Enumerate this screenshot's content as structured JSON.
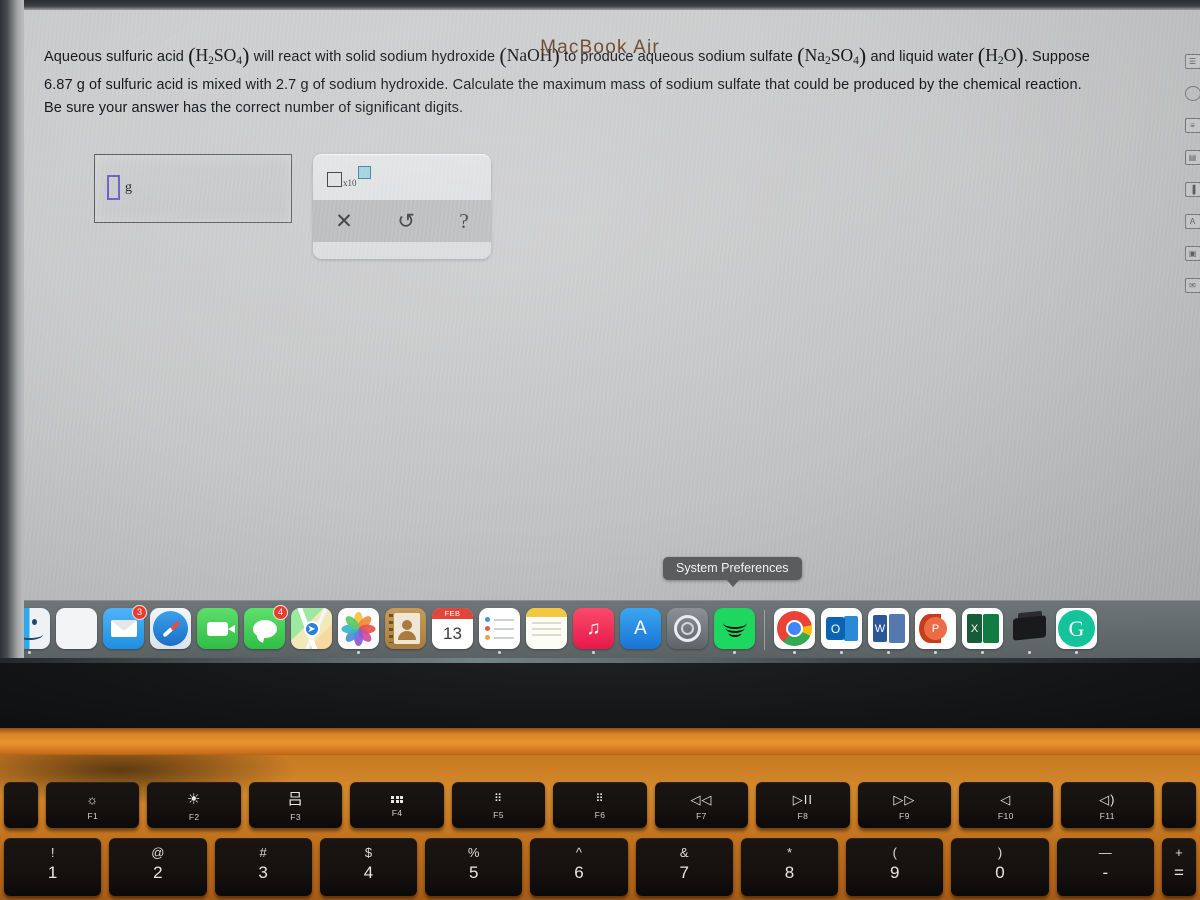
{
  "problem": {
    "line1_a": "Aqueous sulfuric acid ",
    "f_h2so4": "H2SO4",
    "line1_b": " will react with solid sodium hydroxide ",
    "f_naoh": "NaOH",
    "line1_c": " to produce aqueous sodium sulfate ",
    "f_na2so4": "Na2SO4",
    "line1_d": " and liquid water ",
    "f_h2o": "H2O",
    "line1_e": ". Suppose",
    "line2": "6.87 g of sulfuric acid is mixed with 2.7 g of sodium hydroxide. Calculate the maximum mass of sodium sulfate that could be produced by the chemical reaction.",
    "line3": "Be sure your answer has the correct number of significant digits."
  },
  "answer": {
    "value": "",
    "placeholder": "",
    "unit": "g"
  },
  "toolbar": {
    "sci_notation_label": "x10",
    "clear_label": "✕",
    "undo_label": "↺",
    "help_label": "?"
  },
  "right_rail": {
    "items": [
      {
        "name": "page-icon",
        "glyph": "☰"
      },
      {
        "name": "circle-icon",
        "glyph": ""
      },
      {
        "name": "list-icon",
        "glyph": "≡"
      },
      {
        "name": "book-icon",
        "glyph": "▤"
      },
      {
        "name": "chart-icon",
        "glyph": "▐"
      },
      {
        "name": "font-icon",
        "glyph": "A"
      },
      {
        "name": "window-icon",
        "glyph": "▣"
      },
      {
        "name": "mail-icon",
        "glyph": "✉"
      }
    ]
  },
  "tooltip": {
    "text": "System Preferences"
  },
  "dock": {
    "items": [
      {
        "name": "finder",
        "badge": null
      },
      {
        "name": "launchpad",
        "badge": null
      },
      {
        "name": "mail",
        "badge": "3"
      },
      {
        "name": "safari",
        "badge": null
      },
      {
        "name": "facetime",
        "badge": null
      },
      {
        "name": "messages",
        "badge": "4"
      },
      {
        "name": "maps",
        "badge": null
      },
      {
        "name": "photos",
        "badge": null
      },
      {
        "name": "contacts",
        "badge": null
      },
      {
        "name": "calendar",
        "badge": null,
        "month": "FEB",
        "day": "13"
      },
      {
        "name": "reminders",
        "badge": null
      },
      {
        "name": "notes",
        "badge": null
      },
      {
        "name": "music",
        "badge": null
      },
      {
        "name": "app-store",
        "badge": null
      },
      {
        "name": "system-preferences",
        "badge": null
      },
      {
        "name": "spotify",
        "badge": null
      },
      {
        "name": "chrome",
        "badge": null
      },
      {
        "name": "outlook",
        "badge": null,
        "letter": "O"
      },
      {
        "name": "word",
        "badge": null,
        "letter": "W"
      },
      {
        "name": "powerpoint",
        "badge": null,
        "letter": "P"
      },
      {
        "name": "excel",
        "badge": null,
        "letter": "X"
      },
      {
        "name": "printer",
        "badge": null
      },
      {
        "name": "grammarly",
        "badge": null,
        "letter": "G"
      }
    ]
  },
  "laptop": {
    "model": "MacBook Air"
  },
  "keyboard": {
    "function_row": [
      {
        "label": "F1",
        "glyph": "brightness-down"
      },
      {
        "label": "F2",
        "glyph": "brightness-up"
      },
      {
        "label": "F3",
        "glyph": "mission-control"
      },
      {
        "label": "F4",
        "glyph": "launchpad"
      },
      {
        "label": "F5",
        "glyph": "keyboard-dim"
      },
      {
        "label": "F6",
        "glyph": "keyboard-bright"
      },
      {
        "label": "F7",
        "glyph": "◁◁"
      },
      {
        "label": "F8",
        "glyph": "▷II"
      },
      {
        "label": "F9",
        "glyph": "▷▷"
      },
      {
        "label": "F10",
        "glyph": "◁"
      },
      {
        "label": "F11",
        "glyph": "◁)"
      }
    ],
    "number_row": [
      {
        "upper": "!",
        "lower": "1"
      },
      {
        "upper": "@",
        "lower": "2"
      },
      {
        "upper": "#",
        "lower": "3"
      },
      {
        "upper": "$",
        "lower": "4"
      },
      {
        "upper": "%",
        "lower": "5"
      },
      {
        "upper": "^",
        "lower": "6"
      },
      {
        "upper": "&",
        "lower": "7"
      },
      {
        "upper": "*",
        "lower": "8"
      },
      {
        "upper": "(",
        "lower": "9"
      },
      {
        "upper": ")",
        "lower": "0"
      },
      {
        "upper": "—",
        "lower": "-"
      },
      {
        "upper": "+",
        "lower": "="
      }
    ]
  },
  "colors": {
    "accent_input": "#6a62c0",
    "sci_superscript": "#9fd0dd",
    "badge": "#ec3b2e",
    "dock_bg": "#686f71",
    "deck": "#c87a23"
  }
}
